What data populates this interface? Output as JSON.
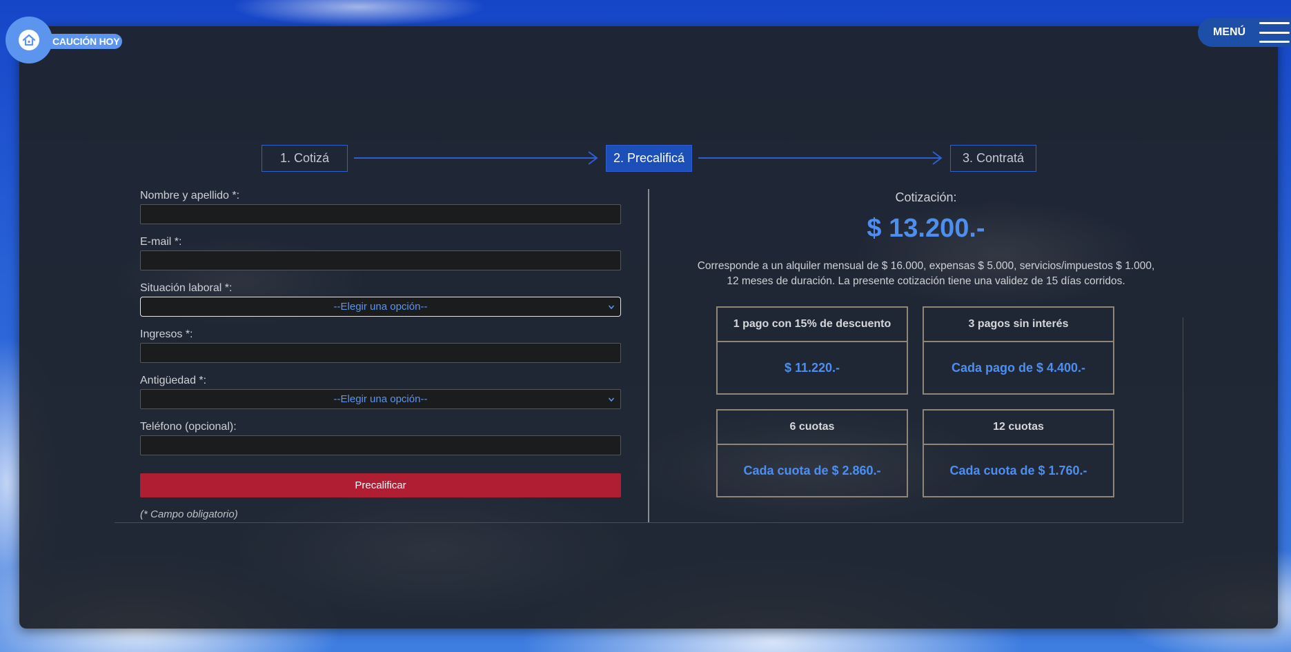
{
  "brand": {
    "name": "CAUCIÓN HOY",
    "icon": "house-icon"
  },
  "menu": {
    "label": "MENÚ",
    "icon": "hamburger-icon"
  },
  "steps": [
    {
      "label": "1. Cotizá",
      "active": false
    },
    {
      "label": "2. Precalificá",
      "active": true
    },
    {
      "label": "3. Contratá",
      "active": false
    }
  ],
  "form": {
    "fields": [
      {
        "label": "Nombre y apellido *:",
        "type": "text",
        "value": ""
      },
      {
        "label": "E-mail *:",
        "type": "email",
        "value": ""
      },
      {
        "label": "Situación laboral *:",
        "type": "select",
        "value": "--Elegir una opción--"
      },
      {
        "label": "Ingresos *:",
        "type": "text",
        "value": ""
      },
      {
        "label": "Antigüedad *:",
        "type": "select",
        "value": "--Elegir una opción--"
      },
      {
        "label": "Teléfono (opcional):",
        "type": "tel",
        "value": ""
      }
    ],
    "submit_label": "Precalificar",
    "required_note": "(* Campo obligatorio)"
  },
  "quote": {
    "title": "Cotización:",
    "amount": "$ 13.200.-",
    "description": "Corresponde a un alquiler mensual de $ 16.000, expensas $ 5.000, servicios/impuestos $ 1.000, 12 meses de duración. La presente cotización tiene una validez de 15 días corridos.",
    "plans": [
      {
        "title": "1 pago con 15% de descuento",
        "value": "$ 11.220.-"
      },
      {
        "title": "3 pagos sin interés",
        "value": "Cada pago de $ 4.400.-"
      },
      {
        "title": "6 cuotas",
        "value": "Cada cuota de $ 2.860.-"
      },
      {
        "title": "12 cuotas",
        "value": "Cada cuota de $ 1.760.-"
      }
    ]
  },
  "colors": {
    "accent": "#4d8ff0",
    "step_border": "#2f5fd0",
    "step_active_bg": "#1d4fb8",
    "button": "#b01e33",
    "card_bg": "#1f232a"
  }
}
